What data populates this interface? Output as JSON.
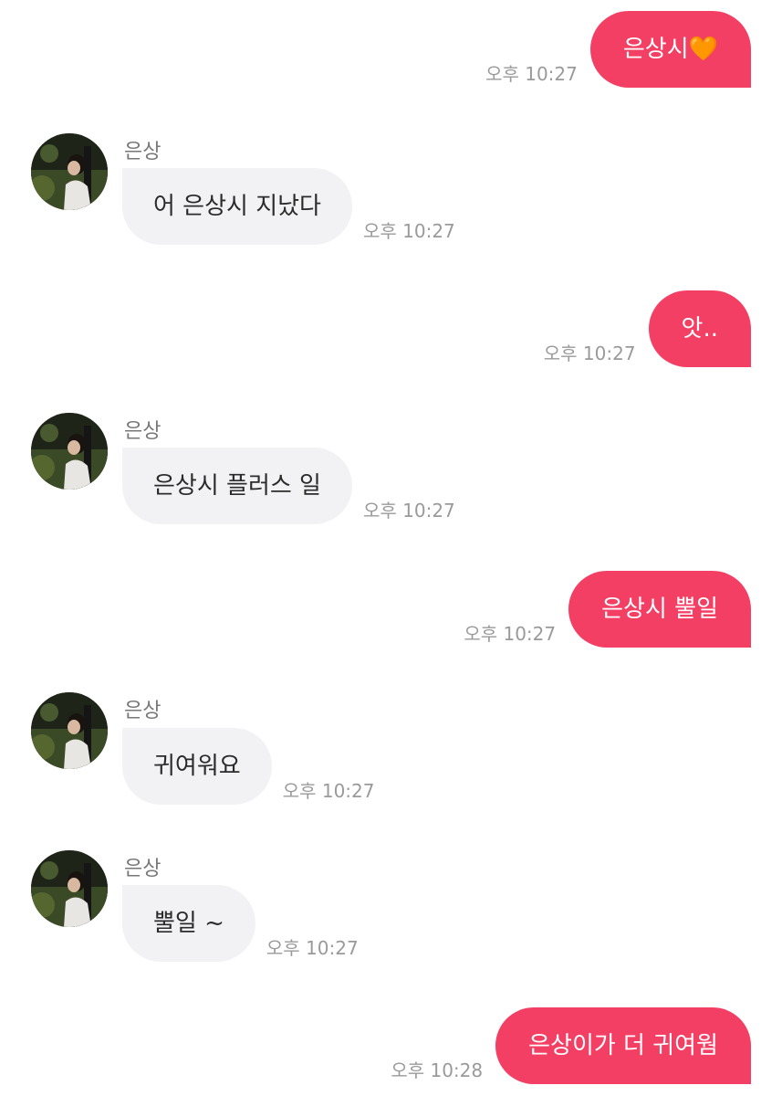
{
  "messages": [
    {
      "from": "me",
      "text": "은상시",
      "emoji": "🧡",
      "time": "오후 10:27"
    },
    {
      "from": "them",
      "sender": "은상",
      "text": "어 은상시 지났다",
      "time": "오후 10:27"
    },
    {
      "from": "me",
      "text": "앗..",
      "time": "오후 10:27"
    },
    {
      "from": "them",
      "sender": "은상",
      "text": "은상시 플러스 일",
      "time": "오후 10:27"
    },
    {
      "from": "me",
      "text": "은상시 뿔일",
      "time": "오후 10:27"
    },
    {
      "from": "them",
      "sender": "은상",
      "text": "귀여워요",
      "time": "오후 10:27"
    },
    {
      "from": "them",
      "sender": "은상",
      "text": "뿔일 ~",
      "time": "오후 10:27"
    },
    {
      "from": "me",
      "text": "은상이가 더 귀여웜",
      "time": "오후 10:28"
    }
  ],
  "colors": {
    "outgoing_bubble": "#f43f64",
    "incoming_bubble": "#f2f2f5",
    "timestamp": "#9a9a9a"
  }
}
